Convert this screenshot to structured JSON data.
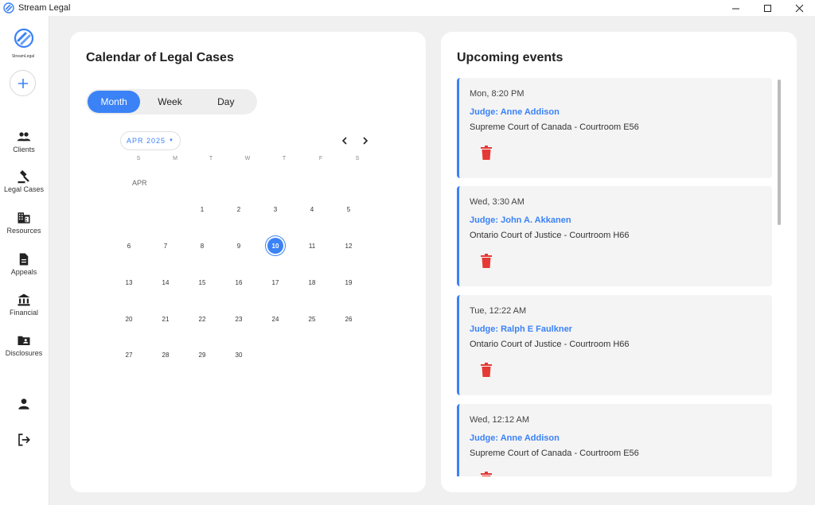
{
  "window": {
    "title": "Stream Legal"
  },
  "sidebar": {
    "logo_text": "StreamLegal",
    "items": [
      {
        "label": "Clients",
        "icon": "people-icon"
      },
      {
        "label": "Legal Cases",
        "icon": "gavel-icon"
      },
      {
        "label": "Resources",
        "icon": "building-icon"
      },
      {
        "label": "Appeals",
        "icon": "document-icon"
      },
      {
        "label": "Financial",
        "icon": "bank-icon"
      },
      {
        "label": "Disclosures",
        "icon": "folder-shared-icon"
      }
    ]
  },
  "calendar": {
    "title": "Calendar of Legal Cases",
    "views": [
      "Month",
      "Week",
      "Day"
    ],
    "active_view": "Month",
    "month_chip": "APR 2025",
    "weekday_headers": [
      "S",
      "M",
      "T",
      "W",
      "T",
      "F",
      "S"
    ],
    "month_label": "APR",
    "days": [
      "1",
      "2",
      "3",
      "4",
      "5",
      "6",
      "7",
      "8",
      "9",
      "10",
      "11",
      "12",
      "13",
      "14",
      "15",
      "16",
      "17",
      "18",
      "19",
      "20",
      "21",
      "22",
      "23",
      "24",
      "25",
      "26",
      "27",
      "28",
      "29",
      "30"
    ],
    "selected_day": "10"
  },
  "events": {
    "title": "Upcoming events",
    "items": [
      {
        "time": "Mon, 8:20 PM",
        "judge": "Judge: Anne Addison",
        "court": "Supreme Court of Canada - Courtroom E56"
      },
      {
        "time": "Wed, 3:30 AM",
        "judge": "Judge: John A. Akkanen",
        "court": "Ontario Court of Justice - Courtroom H66"
      },
      {
        "time": "Tue, 12:22 AM",
        "judge": "Judge: Ralph E Faulkner",
        "court": "Ontario Court of Justice - Courtroom H66"
      },
      {
        "time": "Wed, 12:12 AM",
        "judge": "Judge: Anne Addison",
        "court": "Supreme Court of Canada - Courtroom E56"
      }
    ]
  },
  "colors": {
    "accent": "#3b82f6",
    "delete": "#e53935",
    "card_bg": "#ffffff",
    "page_bg": "#f0f0f0"
  }
}
